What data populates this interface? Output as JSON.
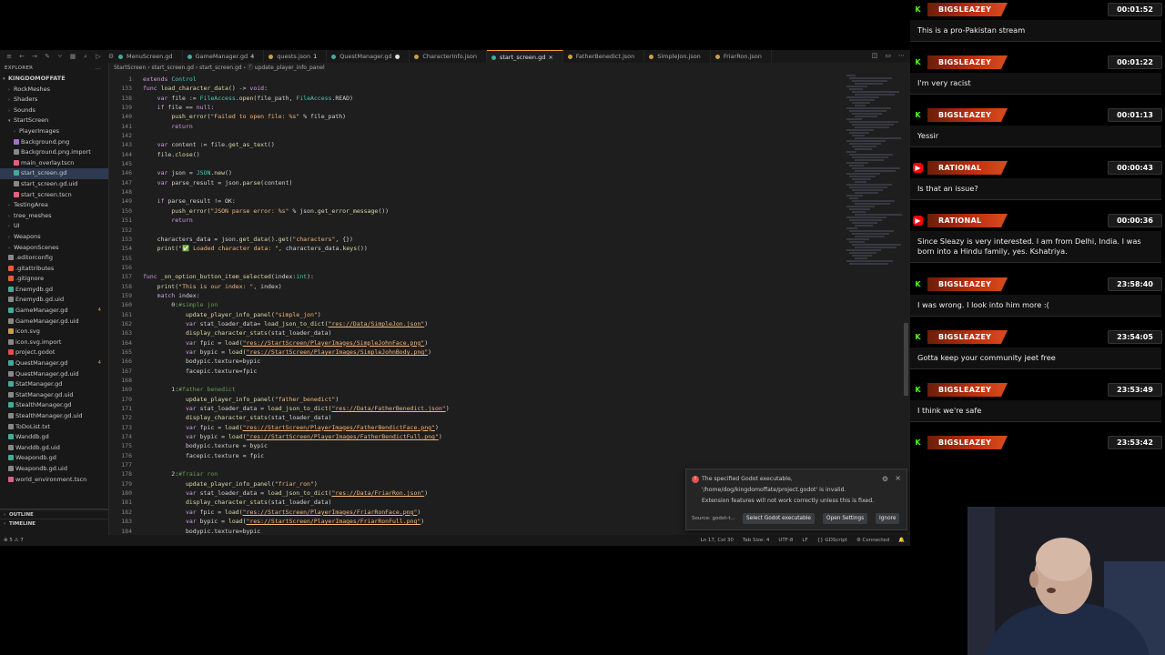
{
  "editor": {
    "tabs": [
      {
        "label": "MenuScreen.gd",
        "dot": "#4a9"
      },
      {
        "label": "GameManager.gd",
        "dot": "#4a9",
        "mod": "4"
      },
      {
        "label": "quests.json",
        "dot": "#c9a040",
        "mod": "1"
      },
      {
        "label": "QuestManager.gd",
        "dot": "#4a9",
        "mod": "●"
      },
      {
        "label": "CharacterInfo.json",
        "dot": "#c9a040"
      },
      {
        "label": "start_screen.gd",
        "dot": "#4a9",
        "active": true,
        "mod": "×"
      },
      {
        "label": "FatherBenedict.json",
        "dot": "#c9a040"
      },
      {
        "label": "SimpleJon.json",
        "dot": "#c9a040"
      },
      {
        "label": "FriarRon.json",
        "dot": "#c9a040"
      }
    ],
    "explorer_label": "EXPLORER",
    "explorer_actions": "...",
    "tree": [
      {
        "label": "KINGDOMOFFATE",
        "indent": 0,
        "chev": "v",
        "bold": true
      },
      {
        "label": "RockMeshes",
        "indent": 1,
        "chev": ">"
      },
      {
        "label": "Shaders",
        "indent": 1,
        "chev": ">"
      },
      {
        "label": "Sounds",
        "indent": 1,
        "chev": ">"
      },
      {
        "label": "StartScreen",
        "indent": 1,
        "chev": "v"
      },
      {
        "label": "PlayerImages",
        "indent": 2,
        "chev": ">"
      },
      {
        "label": "Background.png",
        "indent": 2,
        "icon": "#a070d0"
      },
      {
        "label": "Background.png.import",
        "indent": 2,
        "icon": "#888"
      },
      {
        "label": "main_overlay.tscn",
        "indent": 2,
        "icon": "#e06080"
      },
      {
        "label": "start_screen.gd",
        "indent": 2,
        "icon": "#4a9",
        "selected": true
      },
      {
        "label": "start_screen.gd.uid",
        "indent": 2,
        "icon": "#888"
      },
      {
        "label": "start_screen.tscn",
        "indent": 2,
        "icon": "#e06080"
      },
      {
        "label": "TestingArea",
        "indent": 1,
        "chev": ">"
      },
      {
        "label": "tree_meshes",
        "indent": 1,
        "chev": ">"
      },
      {
        "label": "UI",
        "indent": 1,
        "chev": ">"
      },
      {
        "label": "Weapons",
        "indent": 1,
        "chev": ">"
      },
      {
        "label": "WeaponScenes",
        "indent": 1,
        "chev": ">"
      },
      {
        "label": ".editorconfig",
        "indent": 1,
        "icon": "#888"
      },
      {
        "label": ".gitattributes",
        "indent": 1,
        "icon": "#e06030"
      },
      {
        "label": ".gitignore",
        "indent": 1,
        "icon": "#e06030"
      },
      {
        "label": "Enemydb.gd",
        "indent": 1,
        "icon": "#4a9"
      },
      {
        "label": "Enemydb.gd.uid",
        "indent": 1,
        "icon": "#888"
      },
      {
        "label": "GameManager.gd",
        "indent": 1,
        "icon": "#4a9",
        "badge": "4"
      },
      {
        "label": "GameManager.gd.uid",
        "indent": 1,
        "icon": "#888"
      },
      {
        "label": "icon.svg",
        "indent": 1,
        "icon": "#c9a040"
      },
      {
        "label": "icon.svg.import",
        "indent": 1,
        "icon": "#888"
      },
      {
        "label": "project.godot",
        "indent": 1,
        "icon": "#e05050"
      },
      {
        "label": "QuestManager.gd",
        "indent": 1,
        "icon": "#4a9",
        "badge": "4"
      },
      {
        "label": "QuestManager.gd.uid",
        "indent": 1,
        "icon": "#888"
      },
      {
        "label": "StatManager.gd",
        "indent": 1,
        "icon": "#4a9"
      },
      {
        "label": "StatManager.gd.uid",
        "indent": 1,
        "icon": "#888"
      },
      {
        "label": "StealthManager.gd",
        "indent": 1,
        "icon": "#4a9"
      },
      {
        "label": "StealthManager.gd.uid",
        "indent": 1,
        "icon": "#888"
      },
      {
        "label": "ToDoList.txt",
        "indent": 1,
        "icon": "#888"
      },
      {
        "label": "Wanddb.gd",
        "indent": 1,
        "icon": "#4a9"
      },
      {
        "label": "Wanddb.gd.uid",
        "indent": 1,
        "icon": "#888"
      },
      {
        "label": "Weapondb.gd",
        "indent": 1,
        "icon": "#4a9"
      },
      {
        "label": "Weapondb.gd.uid",
        "indent": 1,
        "icon": "#888"
      },
      {
        "label": "world_environment.tscn",
        "indent": 1,
        "icon": "#e06080"
      }
    ],
    "outline_label": "OUTLINE",
    "timeline_label": "TIMELINE",
    "breadcrumb": "StartScreen › start_screen.gd › start_screen.gd › ⓕ update_player_info_panel",
    "code": [
      {
        "n": "1",
        "h": "<span class=\"k\">extends</span> <span class=\"t\">Control</span>"
      },
      {
        "n": "133",
        "h": "<span class=\"k\">func</span> <span class=\"f\">load_character_data</span>() -> <span class=\"k\">void</span>:"
      },
      {
        "n": "138",
        "h": "    <span class=\"k\">var</span> file := <span class=\"t\">FileAccess</span>.<span class=\"f\">open</span>(file_path, <span class=\"t\">FileAccess</span>.READ)"
      },
      {
        "n": "139",
        "h": "    <span class=\"k\">if</span> file == <span class=\"k\">null</span>:"
      },
      {
        "n": "140",
        "h": "        <span class=\"f\">push_error</span>(<span class=\"s\">\"Failed to open file: %s\"</span> % file_path)"
      },
      {
        "n": "141",
        "h": "        <span class=\"k\">return</span>"
      },
      {
        "n": "142",
        "h": ""
      },
      {
        "n": "143",
        "h": "    <span class=\"k\">var</span> content := file.<span class=\"f\">get_as_text</span>()"
      },
      {
        "n": "144",
        "h": "    file.<span class=\"f\">close</span>()"
      },
      {
        "n": "145",
        "h": ""
      },
      {
        "n": "146",
        "h": "    <span class=\"k\">var</span> json = <span class=\"t\">JSON</span>.<span class=\"f\">new</span>()"
      },
      {
        "n": "147",
        "h": "    <span class=\"k\">var</span> parse_result = json.<span class=\"f\">parse</span>(content)"
      },
      {
        "n": "148",
        "h": ""
      },
      {
        "n": "149",
        "h": "    <span class=\"k\">if</span> parse_result != OK:"
      },
      {
        "n": "150",
        "h": "        <span class=\"f\">push_error</span>(<span class=\"s\">\"JSON parse error: %s\"</span> % json.<span class=\"f\">get_error_message</span>())"
      },
      {
        "n": "151",
        "h": "        <span class=\"k\">return</span>"
      },
      {
        "n": "152",
        "h": ""
      },
      {
        "n": "153",
        "h": "    characters_data = json.<span class=\"f\">get_data</span>().<span class=\"f\">get</span>(<span class=\"s\">\"characters\"</span>, {})"
      },
      {
        "n": "154",
        "h": "    <span class=\"f\">print</span>(<span class=\"s\">\"✅ Loaded character data: \"</span>, characters_data.<span class=\"f\">keys</span>())"
      },
      {
        "n": "155",
        "h": ""
      },
      {
        "n": "156",
        "h": ""
      },
      {
        "n": "157",
        "h": "<span class=\"k\">func</span> <span class=\"f\">_on_option_button_item_selected</span>(index:<span class=\"t\">int</span>):"
      },
      {
        "n": "158",
        "h": "    <span class=\"f\">print</span>(<span class=\"s\">\"This is our index: \"</span>, index)"
      },
      {
        "n": "159",
        "h": "    <span class=\"k\">match</span> index:"
      },
      {
        "n": "160",
        "h": "        0:<span class=\"c\">#simple jon</span>"
      },
      {
        "n": "161",
        "h": "            <span class=\"f\">update_player_info_panel</span>(<span class=\"s\">\"simple_jon\"</span>)"
      },
      {
        "n": "162",
        "h": "            <span class=\"k\">var</span> stat_loader_data= <span class=\"f\">load_json_to_dict</span>(<span class=\"u\">\"res://Data/SimpleJon.json\"</span>)"
      },
      {
        "n": "163",
        "h": "            <span class=\"f\">display_character_stats</span>(stat_loader_data)"
      },
      {
        "n": "164",
        "h": "            <span class=\"k\">var</span> fpic = <span class=\"f\">load</span>(<span class=\"u\">\"res://StartScreen/PlayerImages/SimpleJohnFace.png\"</span>)"
      },
      {
        "n": "165",
        "h": "            <span class=\"k\">var</span> bypic = <span class=\"f\">load</span>(<span class=\"u\">\"res://StartScreen/PlayerImages/SimpleJohnBody.png\"</span>)"
      },
      {
        "n": "166",
        "h": "            bodypic.texture=bypic"
      },
      {
        "n": "167",
        "h": "            facepic.texture=fpic"
      },
      {
        "n": "168",
        "h": ""
      },
      {
        "n": "169",
        "h": "        1:<span class=\"c\">#father benedict</span>"
      },
      {
        "n": "170",
        "h": "            <span class=\"f\">update_player_info_panel</span>(<span class=\"s\">\"father_benedict\"</span>)"
      },
      {
        "n": "171",
        "h": "            <span class=\"k\">var</span> stat_loader_data = <span class=\"f\">load_json_to_dict</span>(<span class=\"u\">\"res://Data/FatherBenedict.json\"</span>)"
      },
      {
        "n": "172",
        "h": "            <span class=\"f\">display_character_stats</span>(stat_loader_data)"
      },
      {
        "n": "173",
        "h": "            <span class=\"k\">var</span> fpic = <span class=\"f\">load</span>(<span class=\"u\">\"res://StartScreen/PlayerImages/FatherBendictFace.png\"</span>)"
      },
      {
        "n": "174",
        "h": "            <span class=\"k\">var</span> bypic = <span class=\"f\">load</span>(<span class=\"u\">\"res://StartScreen/PlayerImages/FatherBendictFull.png\"</span>)"
      },
      {
        "n": "175",
        "h": "            bodypic.texture = bypic"
      },
      {
        "n": "176",
        "h": "            facepic.texture = fpic"
      },
      {
        "n": "177",
        "h": ""
      },
      {
        "n": "178",
        "h": "        2:<span class=\"c\">#fraiar ron</span>"
      },
      {
        "n": "179",
        "h": "            <span class=\"f\">update_player_info_panel</span>(<span class=\"s\">\"friar_ron\"</span>)"
      },
      {
        "n": "180",
        "h": "            <span class=\"k\">var</span> stat_loader_data = <span class=\"f\">load_json_to_dict</span>(<span class=\"u\">\"res://Data/FriarRon.json\"</span>)"
      },
      {
        "n": "181",
        "h": "            <span class=\"f\">display_character_stats</span>(stat_loader_data)"
      },
      {
        "n": "182",
        "h": "            <span class=\"k\">var</span> fpic = <span class=\"f\">load</span>(<span class=\"u\">\"res://StartScreen/PlayerImages/FriarRonFace.png\"</span>)"
      },
      {
        "n": "183",
        "h": "            <span class=\"k\">var</span> bypic = <span class=\"f\">load</span>(<span class=\"u\">\"res://StartScreen/PlayerImages/FriarRonFull.png\"</span>)"
      },
      {
        "n": "184",
        "h": "            bodypic.texture=bypic"
      }
    ],
    "status_left": "⊗ 5 ⚠ 7",
    "status_right": [
      "Ln 17, Col 30",
      "Tab Size: 4",
      "UTF-8",
      "LF",
      "{} GDScript",
      "⚙ Connected",
      "🔔"
    ],
    "toast": {
      "line1": "The specified Godot executable,",
      "line2": "'/home/dog/kingdomoffate/project.godot' is invalid.",
      "line3": "Extension features will not work correctly unless this is fixed.",
      "source": "Source: godot-t...",
      "btn_select": "Select Godot executable",
      "btn_settings": "Open Settings",
      "btn_ignore": "Ignore"
    }
  },
  "chat": {
    "messages": [
      {
        "platform": "kick",
        "user": "BIGSLEAZEY",
        "time": "00:01:52",
        "text": "This is a pro-Pakistan stream"
      },
      {
        "platform": "kick",
        "user": "BIGSLEAZEY",
        "time": "00:01:22",
        "text": "I'm very racist"
      },
      {
        "platform": "kick",
        "user": "BIGSLEAZEY",
        "time": "00:01:13",
        "text": "Yessir"
      },
      {
        "platform": "youtube",
        "user": "RATIONAL RAMA",
        "time": "00:00:43",
        "text": "Is that an issue?"
      },
      {
        "platform": "youtube",
        "user": "RATIONAL RAMA",
        "time": "00:00:36",
        "text": "Since Sleazy is very interested. I am from Delhi, India. I was born into a Hindu family, yes. Kshatriya."
      },
      {
        "platform": "kick",
        "user": "BIGSLEAZEY",
        "time": "23:58:40",
        "text": "I was wrong. I look into him more :("
      },
      {
        "platform": "kick",
        "user": "BIGSLEAZEY",
        "time": "23:54:05",
        "text": "Gotta keep your community jeet free"
      },
      {
        "platform": "kick",
        "user": "BIGSLEAZEY",
        "time": "23:53:49",
        "text": "I think we're safe"
      },
      {
        "platform": "kick",
        "user": "BIGSLEAZEY",
        "time": "23:53:42",
        "text": ""
      }
    ]
  }
}
